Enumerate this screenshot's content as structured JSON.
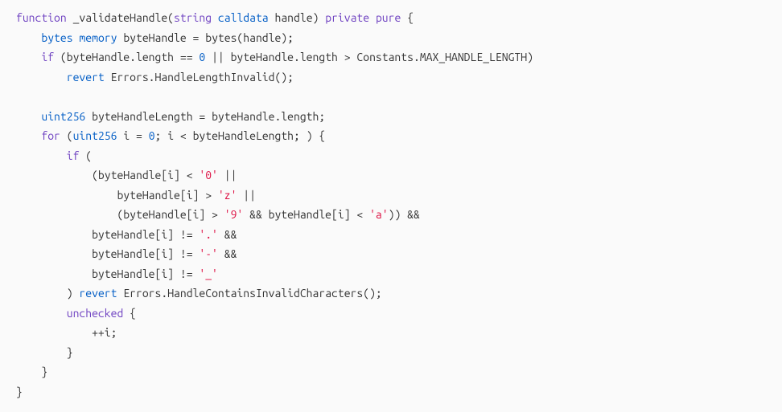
{
  "code": {
    "lines": [
      {
        "indent": 0,
        "tokens": [
          {
            "t": "kw",
            "v": "function"
          },
          {
            "t": "sp",
            "v": " "
          },
          {
            "t": "ident",
            "v": "_validateHandle("
          },
          {
            "t": "kw",
            "v": "string"
          },
          {
            "t": "sp",
            "v": " "
          },
          {
            "t": "kw2",
            "v": "calldata"
          },
          {
            "t": "sp",
            "v": " "
          },
          {
            "t": "ident",
            "v": "handle) "
          },
          {
            "t": "kw",
            "v": "private"
          },
          {
            "t": "sp",
            "v": " "
          },
          {
            "t": "kw",
            "v": "pure"
          },
          {
            "t": "sp",
            "v": " "
          },
          {
            "t": "ident",
            "v": "{"
          }
        ]
      },
      {
        "indent": 1,
        "tokens": [
          {
            "t": "kw2",
            "v": "bytes"
          },
          {
            "t": "sp",
            "v": " "
          },
          {
            "t": "kw2",
            "v": "memory"
          },
          {
            "t": "sp",
            "v": " "
          },
          {
            "t": "ident",
            "v": "byteHandle = bytes(handle);"
          }
        ]
      },
      {
        "indent": 1,
        "tokens": [
          {
            "t": "kw",
            "v": "if"
          },
          {
            "t": "sp",
            "v": " "
          },
          {
            "t": "ident",
            "v": "(byteHandle.length == "
          },
          {
            "t": "num",
            "v": "0"
          },
          {
            "t": "ident",
            "v": " || byteHandle.length > Constants.MAX_HANDLE_LENGTH)"
          }
        ]
      },
      {
        "indent": 2,
        "tokens": [
          {
            "t": "kw2",
            "v": "revert"
          },
          {
            "t": "sp",
            "v": " "
          },
          {
            "t": "ident",
            "v": "Errors.HandleLengthInvalid();"
          }
        ]
      },
      {
        "indent": 0,
        "tokens": []
      },
      {
        "indent": 1,
        "tokens": [
          {
            "t": "kw2",
            "v": "uint256"
          },
          {
            "t": "sp",
            "v": " "
          },
          {
            "t": "ident",
            "v": "byteHandleLength = byteHandle.length;"
          }
        ]
      },
      {
        "indent": 1,
        "tokens": [
          {
            "t": "kw",
            "v": "for"
          },
          {
            "t": "sp",
            "v": " "
          },
          {
            "t": "ident",
            "v": "("
          },
          {
            "t": "kw2",
            "v": "uint256"
          },
          {
            "t": "sp",
            "v": " "
          },
          {
            "t": "ident",
            "v": "i = "
          },
          {
            "t": "num",
            "v": "0"
          },
          {
            "t": "ident",
            "v": "; i < byteHandleLength; ) {"
          }
        ]
      },
      {
        "indent": 2,
        "tokens": [
          {
            "t": "kw",
            "v": "if"
          },
          {
            "t": "sp",
            "v": " "
          },
          {
            "t": "ident",
            "v": "("
          }
        ]
      },
      {
        "indent": 3,
        "tokens": [
          {
            "t": "ident",
            "v": "(byteHandle[i] < "
          },
          {
            "t": "str",
            "v": "'0'"
          },
          {
            "t": "ident",
            "v": " ||"
          }
        ]
      },
      {
        "indent": 4,
        "tokens": [
          {
            "t": "ident",
            "v": "byteHandle[i] > "
          },
          {
            "t": "str",
            "v": "'z'"
          },
          {
            "t": "ident",
            "v": " ||"
          }
        ]
      },
      {
        "indent": 4,
        "tokens": [
          {
            "t": "ident",
            "v": "(byteHandle[i] > "
          },
          {
            "t": "str",
            "v": "'9'"
          },
          {
            "t": "ident",
            "v": " && byteHandle[i] < "
          },
          {
            "t": "str",
            "v": "'a'"
          },
          {
            "t": "ident",
            "v": ")) &&"
          }
        ]
      },
      {
        "indent": 3,
        "tokens": [
          {
            "t": "ident",
            "v": "byteHandle[i] != "
          },
          {
            "t": "str",
            "v": "'.'"
          },
          {
            "t": "ident",
            "v": " &&"
          }
        ]
      },
      {
        "indent": 3,
        "tokens": [
          {
            "t": "ident",
            "v": "byteHandle[i] != "
          },
          {
            "t": "str",
            "v": "'-'"
          },
          {
            "t": "ident",
            "v": " &&"
          }
        ]
      },
      {
        "indent": 3,
        "tokens": [
          {
            "t": "ident",
            "v": "byteHandle[i] != "
          },
          {
            "t": "str",
            "v": "'_'"
          }
        ]
      },
      {
        "indent": 2,
        "tokens": [
          {
            "t": "ident",
            "v": ") "
          },
          {
            "t": "kw2",
            "v": "revert"
          },
          {
            "t": "sp",
            "v": " "
          },
          {
            "t": "ident",
            "v": "Errors.HandleContainsInvalidCharacters();"
          }
        ]
      },
      {
        "indent": 2,
        "tokens": [
          {
            "t": "kw",
            "v": "unchecked"
          },
          {
            "t": "sp",
            "v": " "
          },
          {
            "t": "ident",
            "v": "{"
          }
        ]
      },
      {
        "indent": 3,
        "tokens": [
          {
            "t": "ident",
            "v": "++i;"
          }
        ]
      },
      {
        "indent": 2,
        "tokens": [
          {
            "t": "ident",
            "v": "}"
          }
        ]
      },
      {
        "indent": 1,
        "tokens": [
          {
            "t": "ident",
            "v": "}"
          }
        ]
      },
      {
        "indent": 0,
        "tokens": [
          {
            "t": "ident",
            "v": "}"
          }
        ]
      }
    ],
    "indentUnit": "    "
  },
  "colors": {
    "keyword": "#6f42c1",
    "typeKeyword": "#005cc5",
    "number": "#005cc5",
    "string": "#d14",
    "text": "#333",
    "bg": "#fafafa"
  }
}
